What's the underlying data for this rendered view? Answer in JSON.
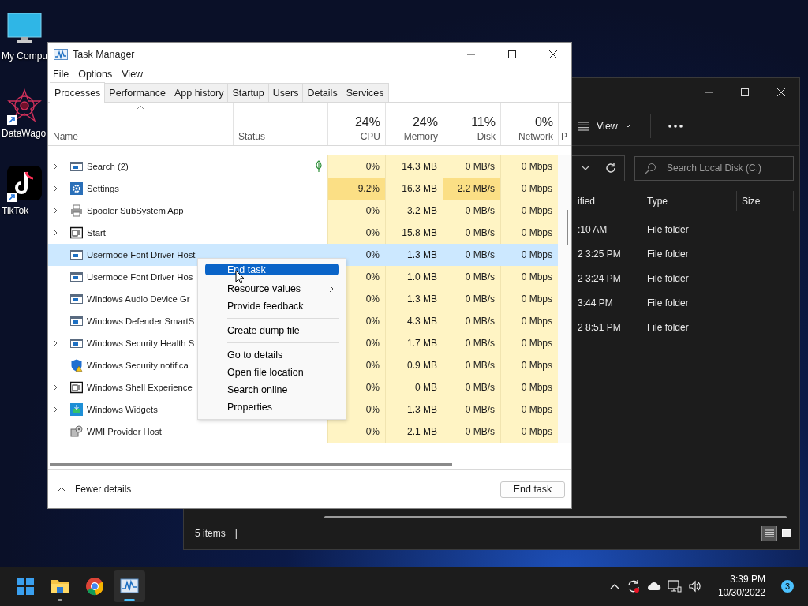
{
  "desktop": {
    "icons": [
      {
        "label": "My Compu",
        "kind": "computer",
        "shortcut": false
      },
      {
        "label": "DataWago",
        "kind": "star",
        "shortcut": true
      },
      {
        "label": "TikTok",
        "kind": "note",
        "shortcut": true
      }
    ]
  },
  "explorer": {
    "view_label": "View",
    "search": {
      "placeholder": "Search Local Disk (C:)"
    },
    "columns": [
      "ified",
      "Type",
      "Size"
    ],
    "rows": [
      {
        "modified": ":10 AM",
        "type": "File folder"
      },
      {
        "modified": "2 3:25 PM",
        "type": "File folder"
      },
      {
        "modified": "2 3:24 PM",
        "type": "File folder"
      },
      {
        "modified": "3:44 PM",
        "type": "File folder"
      },
      {
        "modified": "2 8:51 PM",
        "type": "File folder"
      }
    ],
    "status": "5 items",
    "status_divider": "|",
    "view_modes": [
      {
        "kind": "details",
        "selected": true
      },
      {
        "kind": "tiles",
        "selected": false
      }
    ]
  },
  "task_manager": {
    "title": "Task Manager",
    "menu": [
      "File",
      "Options",
      "View"
    ],
    "tabs": [
      {
        "label": "Processes",
        "selected": true
      },
      {
        "label": "Performance",
        "selected": false
      },
      {
        "label": "App history",
        "selected": false
      },
      {
        "label": "Startup",
        "selected": false
      },
      {
        "label": "Users",
        "selected": false
      },
      {
        "label": "Details",
        "selected": false
      },
      {
        "label": "Services",
        "selected": false
      }
    ],
    "columns": [
      {
        "kind": "name",
        "label": "Name",
        "sorted": true
      },
      {
        "kind": "status",
        "label": "Status",
        "sorted": false
      },
      {
        "kind": "metric",
        "percent": "24%",
        "label": "CPU",
        "sorted": false
      },
      {
        "kind": "metric",
        "percent": "24%",
        "label": "Memory",
        "sorted": false
      },
      {
        "kind": "metric",
        "percent": "11%",
        "label": "Disk",
        "sorted": false
      },
      {
        "kind": "metric",
        "percent": "0%",
        "label": "Network",
        "sorted": false
      },
      {
        "kind": "cut",
        "label": "P",
        "sorted": false
      }
    ],
    "rows": [
      {
        "name": "Search (2)",
        "kind": "app",
        "expandable": true,
        "selected": false,
        "eco": true,
        "busy": false,
        "values": [
          "0%",
          "14.3 MB",
          "0 MB/s",
          "0 Mbps"
        ]
      },
      {
        "name": "Settings",
        "kind": "gear",
        "expandable": true,
        "selected": false,
        "eco": false,
        "busy": true,
        "values": [
          "9.2%",
          "16.3 MB",
          "2.2 MB/s",
          "0 Mbps"
        ]
      },
      {
        "name": "Spooler SubSystem App",
        "kind": "printer",
        "expandable": true,
        "selected": false,
        "eco": false,
        "busy": false,
        "values": [
          "0%",
          "3.2 MB",
          "0 MB/s",
          "0 Mbps"
        ]
      },
      {
        "name": "Start",
        "kind": "dark",
        "expandable": true,
        "selected": false,
        "eco": false,
        "busy": false,
        "values": [
          "0%",
          "15.8 MB",
          "0 MB/s",
          "0 Mbps"
        ]
      },
      {
        "name": "Usermode Font Driver Host",
        "kind": "app",
        "expandable": false,
        "selected": true,
        "eco": false,
        "busy": false,
        "values": [
          "0%",
          "1.3 MB",
          "0 MB/s",
          "0 Mbps"
        ]
      },
      {
        "name": "Usermode Font Driver Hos",
        "kind": "app",
        "expandable": false,
        "selected": false,
        "busy": false,
        "values": [
          "0%",
          "1.0 MB",
          "0 MB/s",
          "0 Mbps"
        ]
      },
      {
        "name": "Windows Audio Device Gr",
        "kind": "app",
        "expandable": false,
        "selected": false,
        "busy": false,
        "values": [
          "0%",
          "1.3 MB",
          "0 MB/s",
          "0 Mbps"
        ]
      },
      {
        "name": "Windows Defender SmartS",
        "kind": "app",
        "expandable": false,
        "selected": false,
        "busy": false,
        "values": [
          "0%",
          "4.3 MB",
          "0 MB/s",
          "0 Mbps"
        ]
      },
      {
        "name": "Windows Security Health S",
        "kind": "app",
        "expandable": true,
        "selected": false,
        "busy": false,
        "values": [
          "0%",
          "1.7 MB",
          "0 MB/s",
          "0 Mbps"
        ]
      },
      {
        "name": "Windows Security notifica",
        "kind": "shield",
        "expandable": false,
        "selected": false,
        "busy": false,
        "values": [
          "0%",
          "0.9 MB",
          "0 MB/s",
          "0 Mbps"
        ]
      },
      {
        "name": "Windows Shell Experience",
        "kind": "dark",
        "expandable": true,
        "selected": false,
        "busy": false,
        "values": [
          "0%",
          "0 MB",
          "0 MB/s",
          "0 Mbps"
        ]
      },
      {
        "name": "Windows Widgets",
        "kind": "widgets",
        "expandable": true,
        "selected": false,
        "eco": false,
        "busy": false,
        "values": [
          "0%",
          "1.3 MB",
          "0 MB/s",
          "0 Mbps"
        ]
      },
      {
        "name": "WMI Provider Host",
        "kind": "gears",
        "expandable": false,
        "selected": false,
        "eco": false,
        "busy": false,
        "values": [
          "0%",
          "2.1 MB",
          "0 MB/s",
          "0 Mbps"
        ]
      }
    ],
    "footer": {
      "toggle": "Fewer details",
      "end_task": "End task"
    }
  },
  "context_menu": {
    "items": [
      {
        "kind": "item",
        "label": "End task",
        "selected": true,
        "submenu": false
      },
      {
        "kind": "item",
        "label": "Resource values",
        "selected": false,
        "submenu": true
      },
      {
        "kind": "item",
        "label": "Provide feedback",
        "selected": false,
        "submenu": false
      },
      {
        "kind": "separator"
      },
      {
        "kind": "item",
        "label": "Create dump file",
        "selected": false,
        "submenu": false
      },
      {
        "kind": "separator"
      },
      {
        "kind": "item",
        "label": "Go to details",
        "selected": false,
        "submenu": false
      },
      {
        "kind": "item",
        "label": "Open file location",
        "selected": false,
        "submenu": false
      },
      {
        "kind": "item",
        "label": "Search online",
        "selected": false,
        "submenu": false
      },
      {
        "kind": "item",
        "label": "Properties",
        "selected": false,
        "submenu": false
      }
    ]
  },
  "taskbar": {
    "apps": [
      {
        "kind": "start",
        "running": false,
        "active": false
      },
      {
        "kind": "folder",
        "running": true,
        "active": false
      },
      {
        "kind": "browser",
        "running": false,
        "active": false
      },
      {
        "kind": "monitor",
        "running": true,
        "active": true
      }
    ],
    "tray": [
      {
        "kind": "caret"
      },
      {
        "kind": "sync"
      },
      {
        "kind": "cloud"
      },
      {
        "kind": "network"
      },
      {
        "kind": "volume"
      }
    ],
    "time": "3:39 PM",
    "date": "10/30/2022",
    "notifications": "3"
  }
}
